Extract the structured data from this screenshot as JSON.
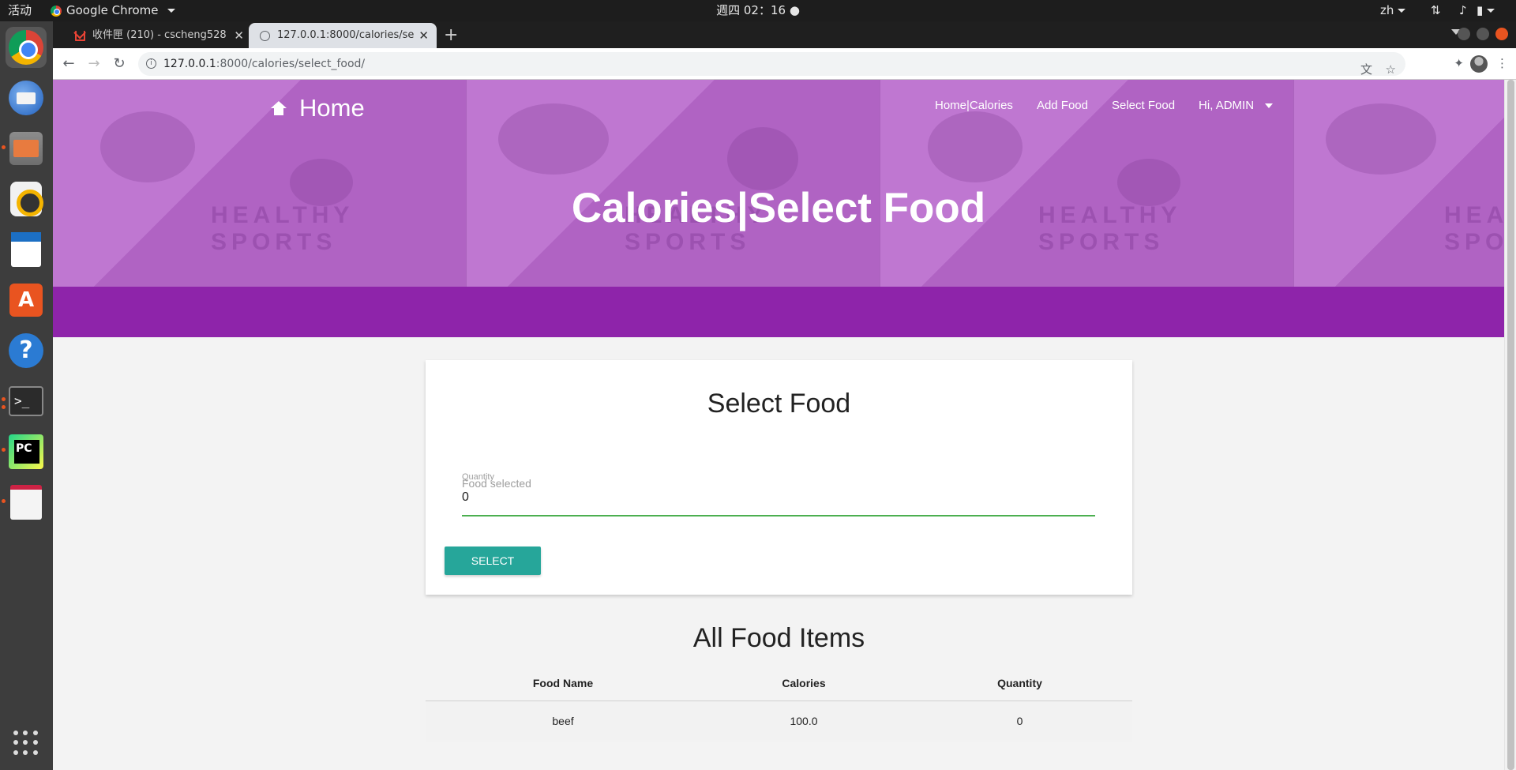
{
  "system": {
    "activities": "活动",
    "app_name": "Google Chrome",
    "clock": "週四 02：16",
    "lang": "zh"
  },
  "browser": {
    "tabs": [
      {
        "title": "收件匣 (210) - cscheng528",
        "icon": "gmail-icon"
      },
      {
        "title": "127.0.0.1:8000/calories/se",
        "icon": "globe-icon"
      }
    ],
    "url_host": "127.0.0.1",
    "url_path": ":8000/calories/select_food/"
  },
  "site": {
    "brand": "Home",
    "nav": [
      "Home|Calories",
      "Add Food",
      "Select Food",
      "Hi, ADMIN"
    ],
    "hero_title": "Calories|Select Food",
    "hero_watermark": [
      "HEALTHY",
      "SPORTS"
    ],
    "colors": {
      "hero": "#bc70cf",
      "band": "#8e24aa",
      "button": "#26a69a",
      "input_line": "#4caf50"
    }
  },
  "form": {
    "title": "Select Food",
    "quantity_label": "Quantity",
    "food_label": "Food selected",
    "quantity_value": "0",
    "submit_label": "SELECT"
  },
  "food_list": {
    "title": "All Food Items",
    "columns": [
      "Food Name",
      "Calories",
      "Quantity"
    ],
    "rows": [
      [
        "beef",
        "100.0",
        "0"
      ]
    ]
  }
}
